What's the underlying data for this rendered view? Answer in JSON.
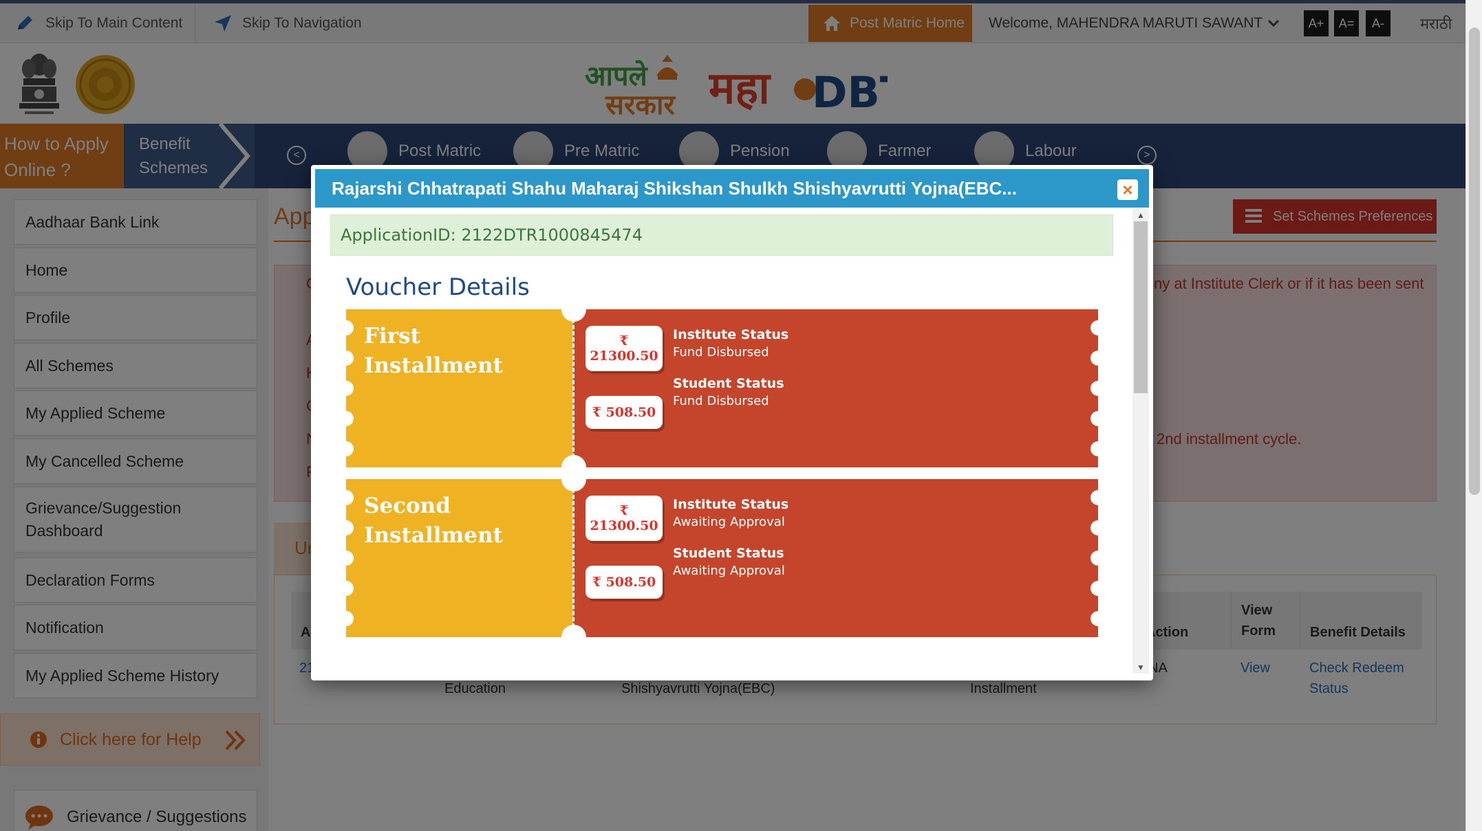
{
  "topbar": {
    "skip_main": "Skip To Main Content",
    "skip_nav": "Skip To Navigation",
    "home_btn": "Post Matric Home",
    "welcome": "Welcome, MAHENDRA MARUTI SAWANT",
    "font_large": "A+",
    "font_normal": "A=",
    "font_small": "A-",
    "language": "मराठी"
  },
  "logo": {
    "aaple_line1": "आपले",
    "aaple_line2": "सरकार",
    "maha": "महा",
    "dbt": "DBT"
  },
  "nav": {
    "how_to": "How to Apply Online ?",
    "benefit": "Benefit Schemes",
    "prev": "<",
    "next": ">",
    "items": [
      {
        "label": "Post Matric"
      },
      {
        "label": "Pre Matric"
      },
      {
        "label": "Pension"
      },
      {
        "label": "Farmer"
      },
      {
        "label": "Labour"
      }
    ]
  },
  "sidebar": {
    "items": [
      {
        "label": "Aadhaar Bank Link"
      },
      {
        "label": "Home"
      },
      {
        "label": "Profile"
      },
      {
        "label": "All Schemes"
      },
      {
        "label": "My Applied Scheme"
      },
      {
        "label": "My Cancelled Scheme"
      },
      {
        "label": "Grievance/Suggestion Dashboard"
      },
      {
        "label": "Declaration Forms"
      },
      {
        "label": "Notification"
      },
      {
        "label": "My Applied Scheme History"
      }
    ],
    "help": "Click here for Help",
    "grievance": "Grievance / Suggestions"
  },
  "main": {
    "title_fragment": "App",
    "set_pref": "Set Schemes Preferences",
    "alert_frag_1": "C",
    "alert_frag_2": "ny at Institute Clerk or if it has been sent",
    "alert_frag_3": "2nd installment cycle.",
    "alert_letters": [
      "A",
      "K",
      "C",
      "N",
      "F"
    ],
    "tab_frag": "Ur",
    "table": {
      "col_ap": "Ap",
      "col_action": "Action",
      "col_view": "View Form",
      "col_benefit": "Benefit Details",
      "cell_id_frag": "21",
      "cell_edu": "Education",
      "cell_scheme": "Shishyavrutti Yojna(EBC)",
      "cell_inst": "Installment",
      "cell_na": "NA",
      "cell_view": "View",
      "cell_check": "Check Redeem Status"
    }
  },
  "modal": {
    "title": "Rajarshi Chhatrapati Shahu Maharaj Shikshan Shulkh Shishyavrutti Yojna(EBC...",
    "close": "×",
    "application_id": "ApplicationID: 2122DTR1000845474",
    "voucher_heading": "Voucher Details",
    "installments": [
      {
        "title_line1": "First",
        "title_line2": "Installment",
        "institute_amount": "₹ 21300.50",
        "student_amount": "₹ 508.50",
        "institute_label": "Institute Status",
        "institute_status": "Fund Disbursed",
        "student_label": "Student Status",
        "student_status": "Fund Disbursed"
      },
      {
        "title_line1": "Second",
        "title_line2": "Installment",
        "institute_amount": "₹ 21300.50",
        "student_amount": "₹ 508.50",
        "institute_label": "Institute Status",
        "institute_status": "Awaiting Approval",
        "student_label": "Student Status",
        "student_status": "Awaiting Approval"
      }
    ]
  },
  "colors": {
    "orange": "#e37b24",
    "navy": "#2d4777",
    "modal_header": "#2c97c9",
    "ticket_yellow": "#efb223",
    "ticket_red": "#c5452c",
    "success_bg": "#dff0d8"
  }
}
